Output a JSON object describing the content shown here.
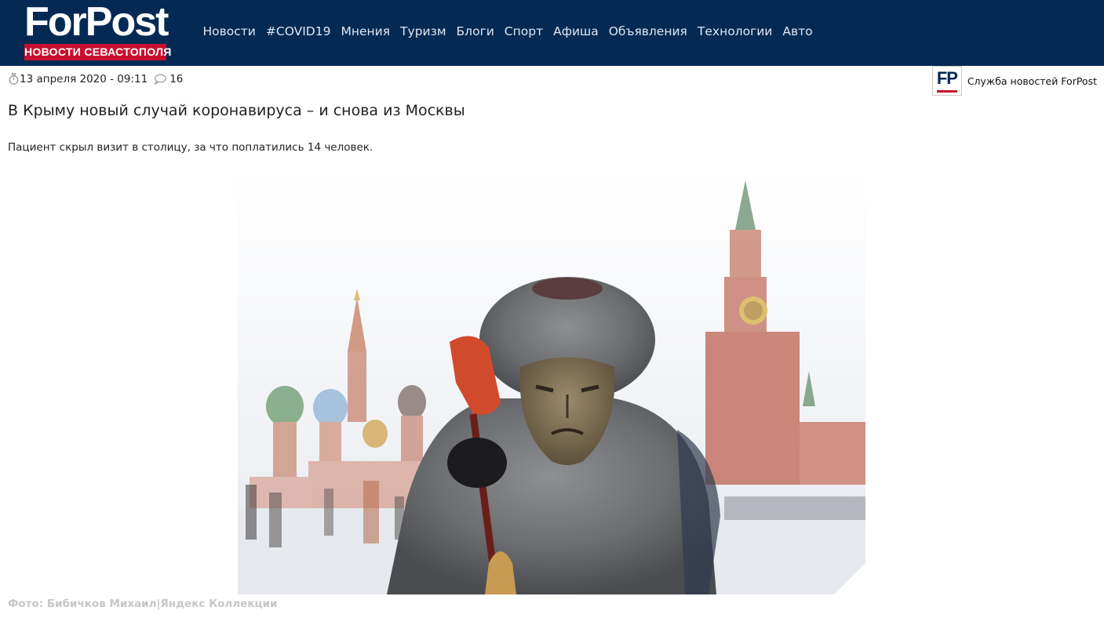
{
  "header": {
    "logo_text": "ForPost",
    "logo_subtitle": "НОВОСТИ СЕВАСТОПОЛЯ",
    "nav": [
      "Новости",
      "#COVID19",
      "Мнения",
      "Туризм",
      "Блоги",
      "Спорт",
      "Афиша",
      "Объявления",
      "Технологии",
      "Авто"
    ]
  },
  "article": {
    "date": "13 апреля 2020 - 09:11",
    "comments_count": "16",
    "author_badge": "FP",
    "author": "Служба новостей ForPost",
    "title": "В Крыму новый случай коронавируса – и снова из Москвы",
    "lead": "Пациент скрыл визит в столицу, за что поплатились 14 человек.",
    "photo_caption": "Фото: Бибичков Михаил|Яндекс Коллекции"
  },
  "colors": {
    "header_bg": "#042a54",
    "brand_red": "#c8102e",
    "caption_gray": "#c6c6c6"
  },
  "icons": {
    "date": "stopwatch-icon",
    "comments": "speech-bubble-icon"
  }
}
